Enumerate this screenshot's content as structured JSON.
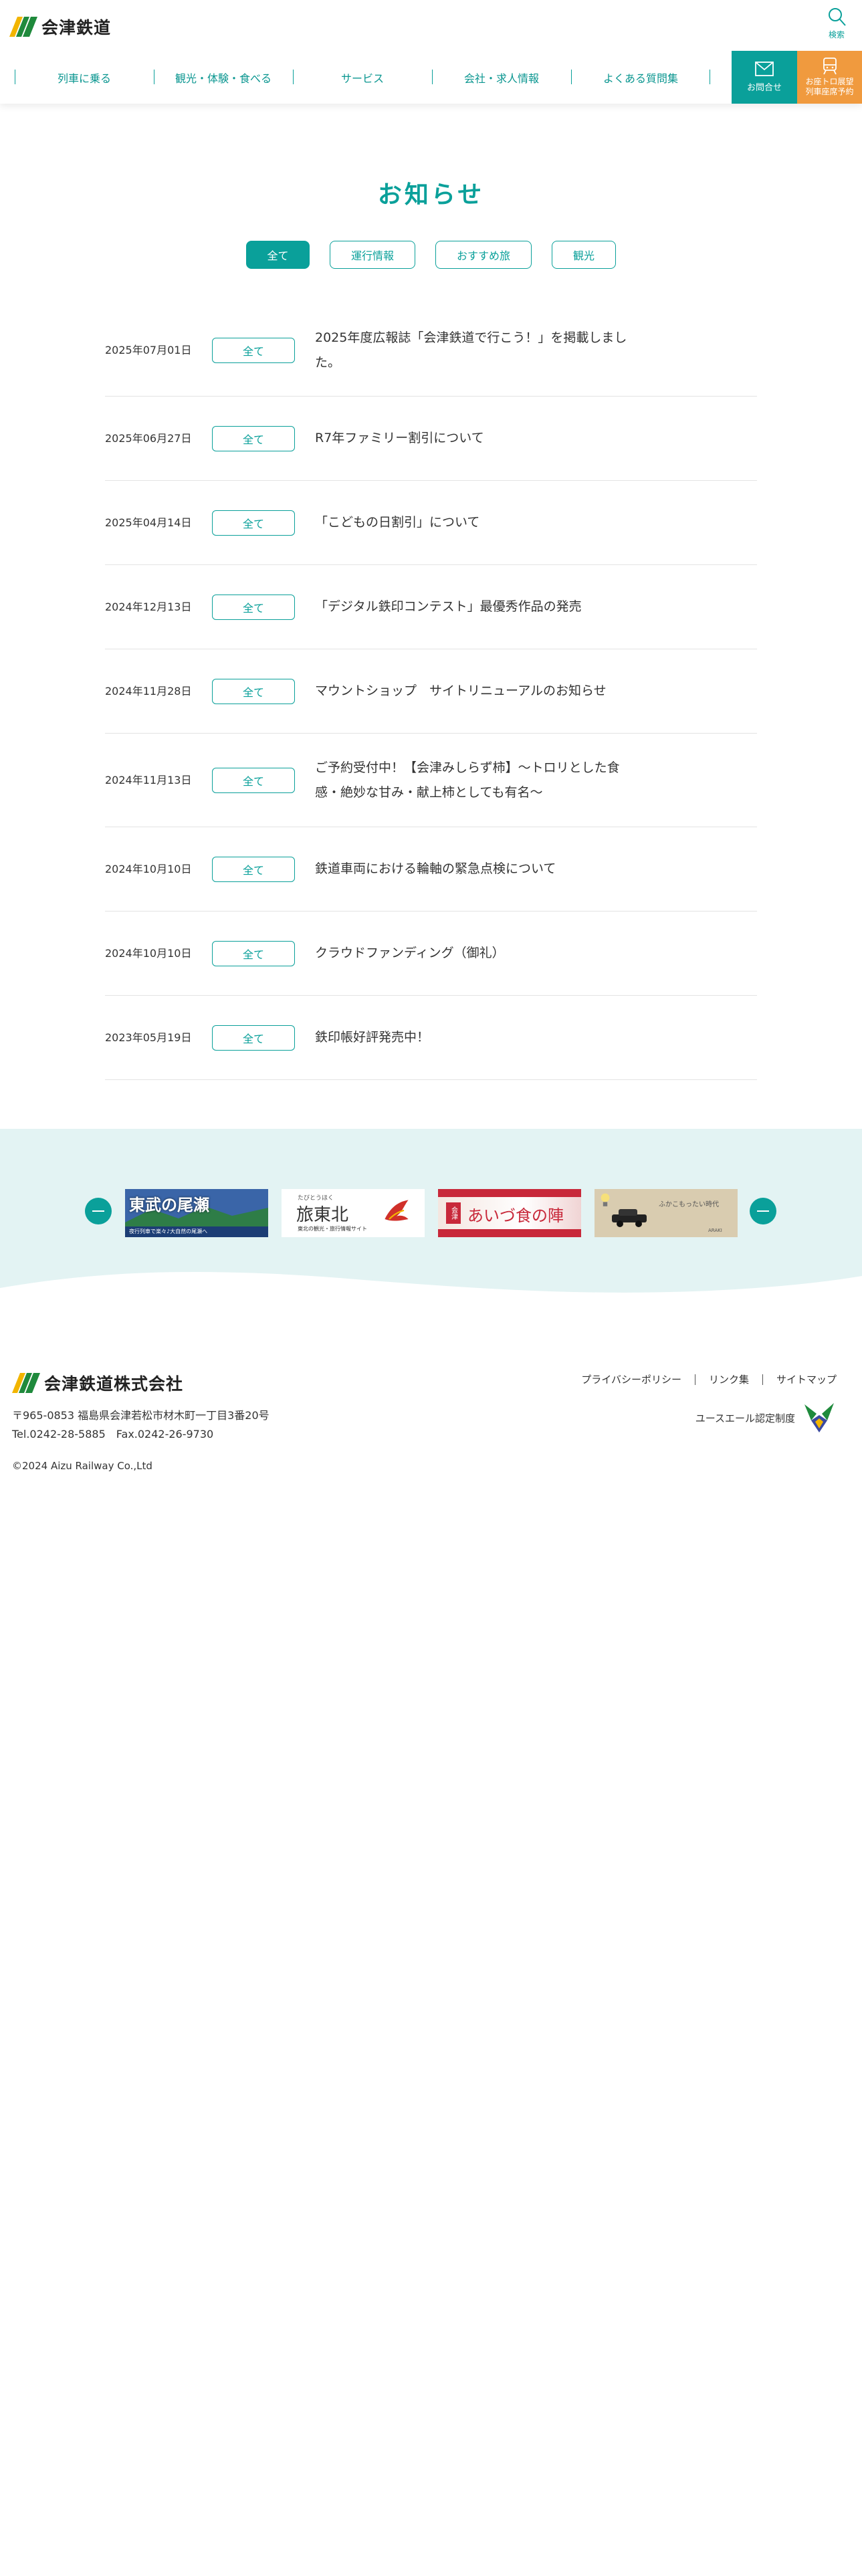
{
  "header": {
    "logo_text": "会津鉄道",
    "search_label": "検索",
    "nav": [
      {
        "label": "列車に乗る"
      },
      {
        "label": "観光・体験・食べる"
      },
      {
        "label": "サービス"
      },
      {
        "label": "会社・求人情報"
      },
      {
        "label": "よくある質問集"
      }
    ],
    "contact_label": "お問合せ",
    "reserve_line1": "お座トロ展望",
    "reserve_line2": "列車座席予約"
  },
  "main": {
    "title": "お知らせ",
    "filters": [
      {
        "label": "全て",
        "active": true
      },
      {
        "label": "運行情報",
        "active": false
      },
      {
        "label": "おすすめ旅",
        "active": false
      },
      {
        "label": "観光",
        "active": false
      }
    ],
    "news": [
      {
        "date": "2025年07月01日",
        "tag": "全て",
        "title": "2025年度広報誌「会津鉄道で行こう！」を掲載しました。"
      },
      {
        "date": "2025年06月27日",
        "tag": "全て",
        "title": "R7年ファミリー割引について"
      },
      {
        "date": "2025年04月14日",
        "tag": "全て",
        "title": "「こどもの日割引」について"
      },
      {
        "date": "2024年12月13日",
        "tag": "全て",
        "title": "「デジタル鉄印コンテスト」最優秀作品の発売"
      },
      {
        "date": "2024年11月28日",
        "tag": "全て",
        "title": "マウントショップ　サイトリニューアルのお知らせ"
      },
      {
        "date": "2024年11月13日",
        "tag": "全て",
        "title": "ご予約受付中！【会津みしらず柿】～トロリとした食感・絶妙な甘み・献上柿としても有名～"
      },
      {
        "date": "2024年10月10日",
        "tag": "全て",
        "title": "鉄道車両における輪軸の緊急点検について"
      },
      {
        "date": "2024年10月10日",
        "tag": "全て",
        "title": "クラウドファンディング（御礼）"
      },
      {
        "date": "2023年05月19日",
        "tag": "全て",
        "title": "鉄印帳好評発売中！"
      }
    ]
  },
  "banners": [
    {
      "title": "東武の尾瀬",
      "caption": "夜行列車で楽々♪大自然の尾瀬へ",
      "colors": {
        "bg": "#2f4f8f",
        "accent": "#ffffff"
      }
    },
    {
      "title": "旅東北",
      "small": "たびとうほく",
      "caption": "東北の観光・旅行情報サイト",
      "colors": {
        "bg": "#ffffff",
        "accent": "#d0302a"
      }
    },
    {
      "title": "あいづ食の陣",
      "badge": "会津",
      "colors": {
        "bg": "#c8283a",
        "accent": "#ffffff"
      }
    },
    {
      "title": "ふかこもったい時代",
      "caption": "ARAKI",
      "colors": {
        "bg": "#d9ccb0",
        "accent": "#555555"
      }
    }
  ],
  "footer": {
    "company_name": "会津鉄道株式会社",
    "address": "〒965-0853 福島県会津若松市材木町一丁目3番20号",
    "tel": "Tel.0242-28-5885　Fax.0242-26-9730",
    "copyright": "©2024 Aizu Railway Co.,Ltd",
    "links": [
      {
        "label": "プライバシーポリシー"
      },
      {
        "label": "リンク集"
      },
      {
        "label": "サイトマップ"
      }
    ],
    "yell_label": "ユースエール認定制度"
  },
  "colors": {
    "primary": "#0aa09a",
    "accent_orange": "#f09a3e",
    "banner_bg": "#e3f3f3"
  }
}
